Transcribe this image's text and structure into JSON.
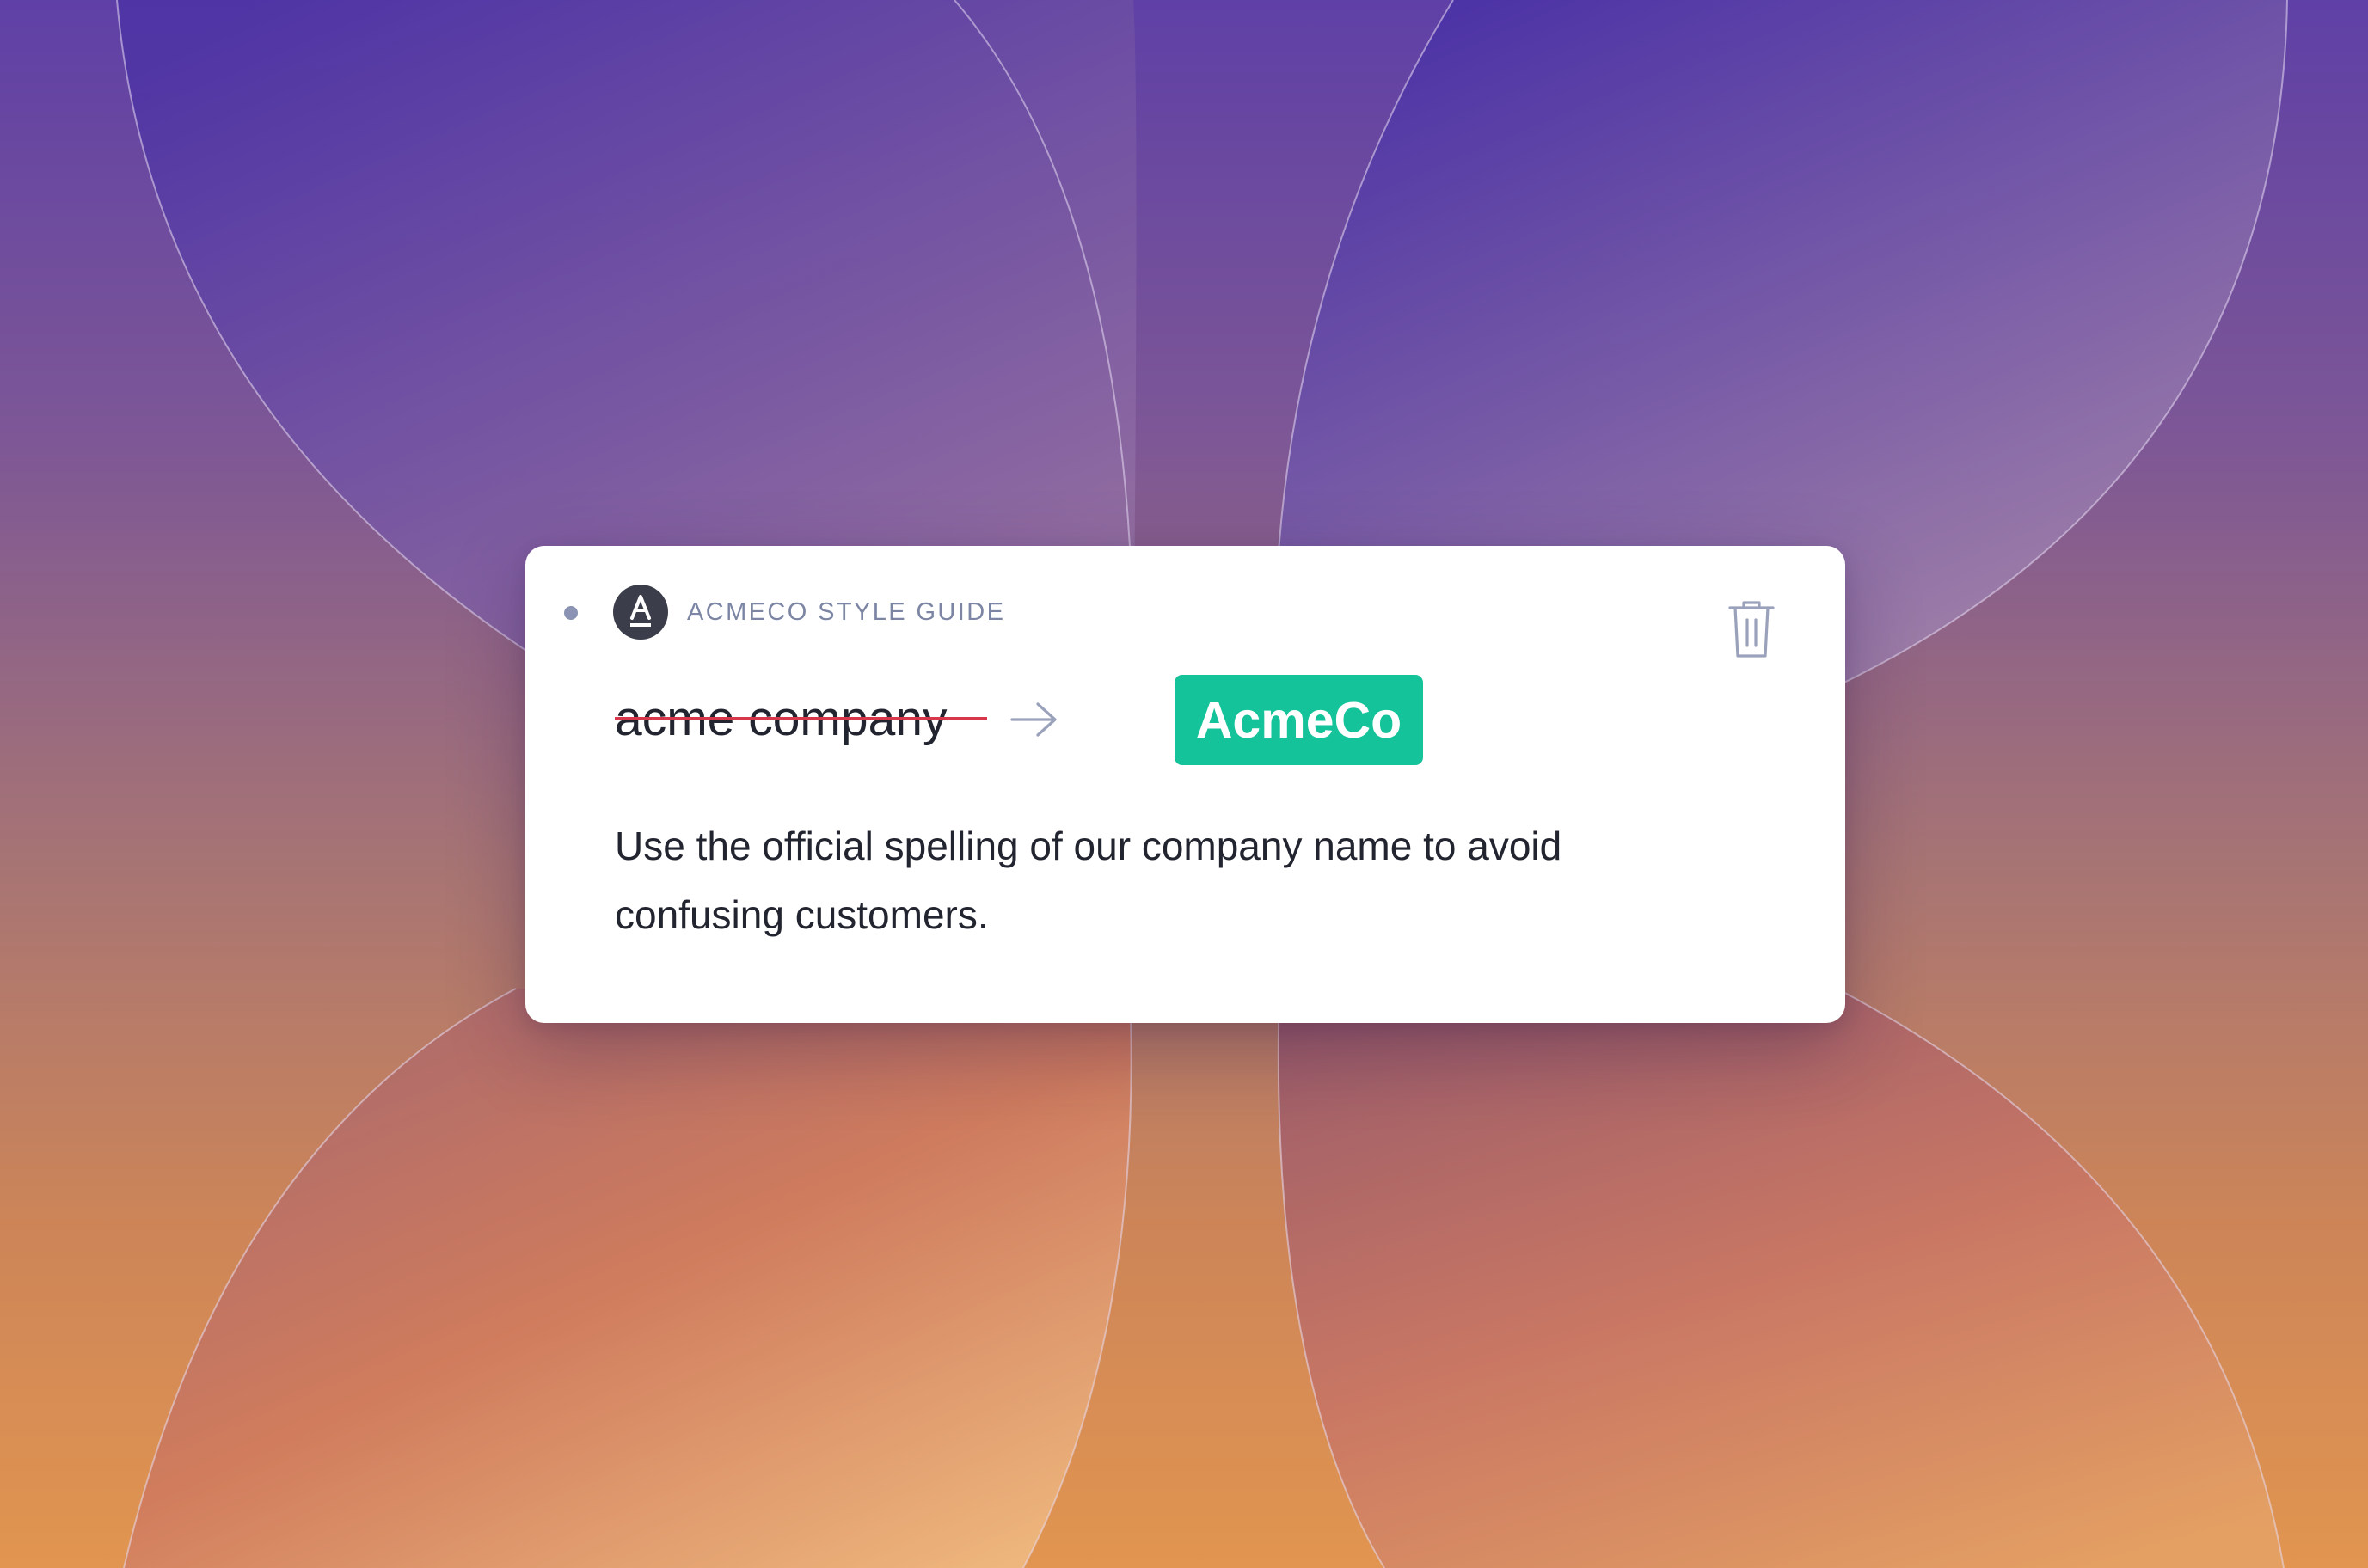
{
  "colors": {
    "background_top": "#5f40a6",
    "background_bottom": "#e19550",
    "card": "#ffffff",
    "accent_green": "#15c39a",
    "strike_red": "#d7364b",
    "muted_gray": "#7c86a4",
    "logo_dark": "#3b3e4a",
    "text_dark": "#222530"
  },
  "card": {
    "source_name": "ACMECO STYLE GUIDE",
    "logo_letter": "A",
    "logo_icon": "style-guide-logo-icon",
    "delete_icon": "trash-icon",
    "suggestion": {
      "original": "acme company",
      "arrow_icon": "arrow-right-icon",
      "replacement": "AcmeCo"
    },
    "explanation": "Use the official spelling of our company name to avoid confusing customers."
  }
}
